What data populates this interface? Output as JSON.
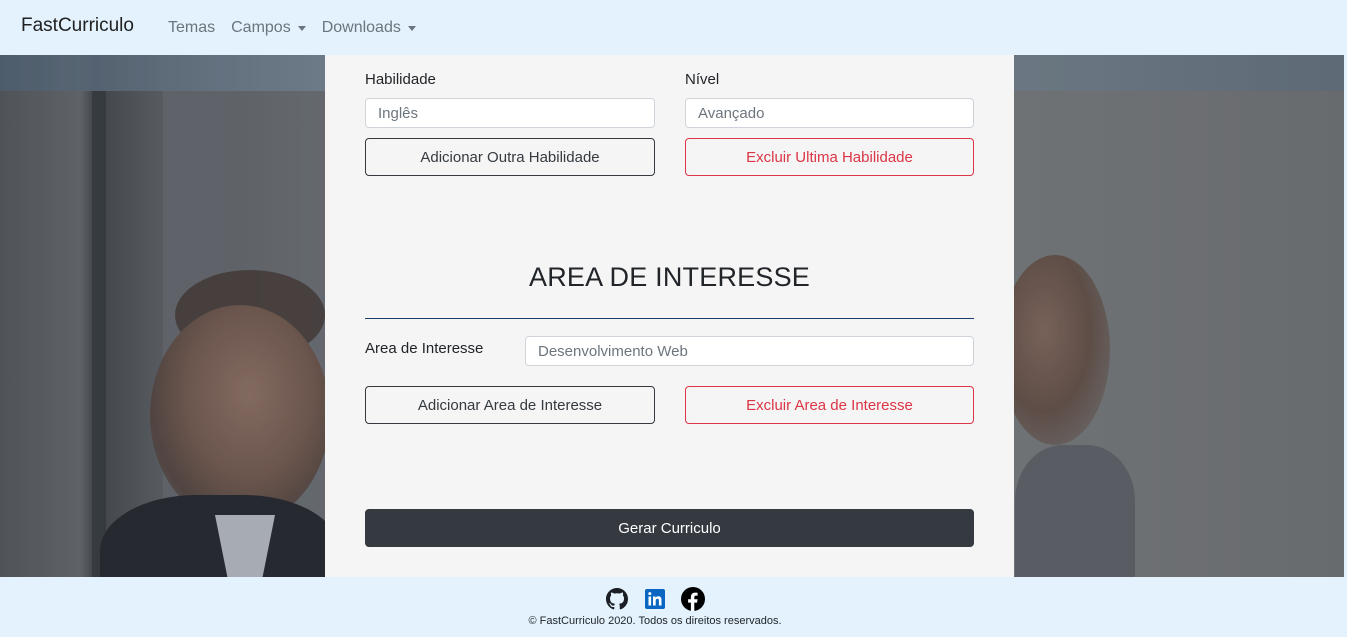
{
  "nav": {
    "brand": "FastCurriculo",
    "items": [
      {
        "label": "Temas",
        "dropdown": false
      },
      {
        "label": "Campos",
        "dropdown": true
      },
      {
        "label": "Downloads",
        "dropdown": true
      }
    ]
  },
  "skills": {
    "skill_label": "Habilidade",
    "skill_placeholder": "Inglês",
    "level_label": "Nível",
    "level_placeholder": "Avançado",
    "add_button": "Adicionar Outra Habilidade",
    "remove_button": "Excluir Ultima Habilidade"
  },
  "interests": {
    "title": "AREA DE INTERESSE",
    "field_label": "Area de Interesse",
    "field_placeholder": "Desenvolvimento Web",
    "add_button": "Adicionar Area de Interesse",
    "remove_button": "Excluir Area de Interesse"
  },
  "generate_button": "Gerar Curriculo",
  "footer": {
    "icons": [
      "github-icon",
      "linkedin-icon",
      "facebook-icon"
    ],
    "copyright": "© FastCurriculo 2020. Todos os direitos reservados."
  },
  "colors": {
    "navbar_bg": "#e3f2fd",
    "danger": "#dc3545",
    "dark": "#343a40",
    "linkedin": "#0a66c2"
  }
}
